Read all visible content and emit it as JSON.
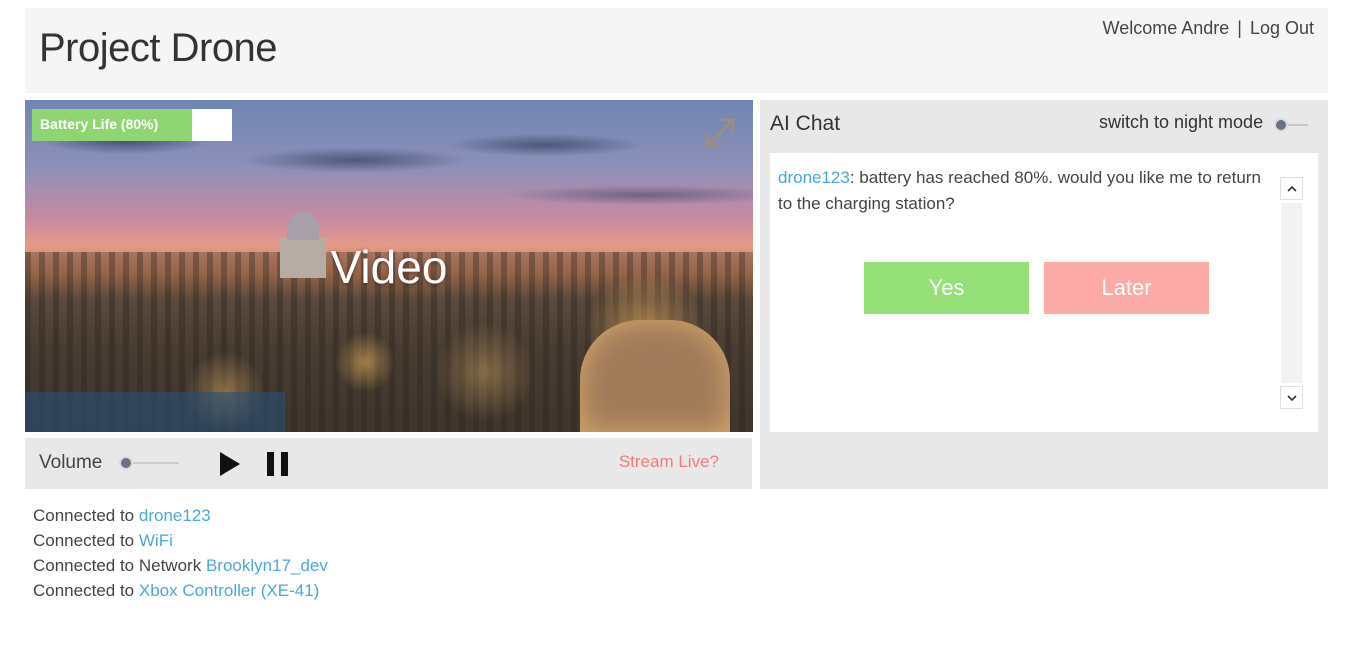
{
  "header": {
    "title": "Project Drone",
    "welcome": "Welcome Andre",
    "separator": "|",
    "logout": "Log Out"
  },
  "video": {
    "label": "Video",
    "battery": {
      "label": "Battery Life (80%)",
      "percent": 80
    },
    "expand_icon": "expand-arrows-icon"
  },
  "controls": {
    "volume_label": "Volume",
    "volume_level": 0,
    "play_icon": "play-icon",
    "pause_icon": "pause-icon",
    "stream_label": "Stream Live?"
  },
  "chat": {
    "title": "AI Chat",
    "night_mode_label": "switch to night mode",
    "night_mode_on": false,
    "message": {
      "sender": "drone123",
      "separator": ":",
      "text": " battery has reached 80%. would you like me to return to the charging station?"
    },
    "yes_label": "Yes",
    "later_label": "Later"
  },
  "connections": [
    {
      "prefix": "Connected to",
      "value": "drone123"
    },
    {
      "prefix": "Connected to",
      "value": "WiFi"
    },
    {
      "prefix": "Connected to Network",
      "value": "Brooklyn17_dev"
    },
    {
      "prefix": "Connected to",
      "value": "Xbox Controller (XE-41)"
    }
  ],
  "colors": {
    "accent_link": "#4aa8d8",
    "stream_link": "#ef7d7d",
    "yes_button": "#96e07a",
    "later_button": "#fbaaa7",
    "battery_fill": "#8fd672"
  }
}
